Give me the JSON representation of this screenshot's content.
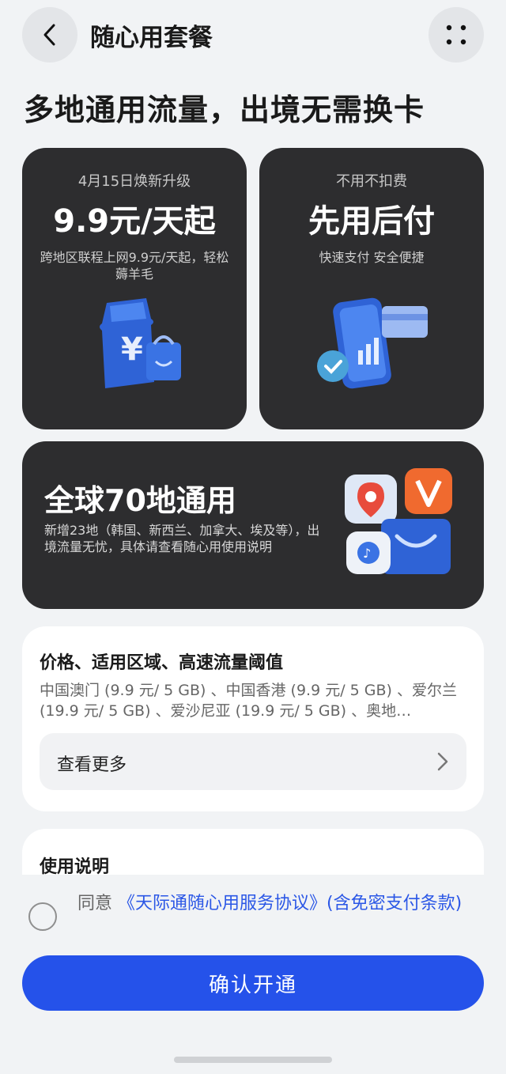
{
  "header": {
    "title": "随心用套餐",
    "back_icon": "chevron-left-icon",
    "more_icon": "more-dots-icon"
  },
  "headline": "多地通用流量，出境无需换卡",
  "cards": [
    {
      "small": "4月15日焕新升级",
      "big": "9.9元/天起",
      "desc": "跨地区联程上网9.9元/天起，轻松薅羊毛",
      "icon": "yen-ticket-bag-icon"
    },
    {
      "small": "不用不扣费",
      "big": "先用后付",
      "desc": "快速支付 安全便捷",
      "icon": "phone-card-check-icon"
    }
  ],
  "global_card": {
    "title": "全球70地通用",
    "desc": "新增23地（韩国、新西兰、加拿大、埃及等），出境流量无忧，具体请查看随心用使用说明",
    "icon": "apps-bag-icon"
  },
  "price_panel": {
    "title": "价格、适用区域、高速流量阈值",
    "text": "中国澳门 (9.9 元/ 5 GB) 、中国香港 (9.9 元/ 5 GB) 、爱尔兰 (19.9 元/ 5 GB) 、爱沙尼亚 (19.9 元/ 5 GB) 、奥地…",
    "more_label": "查看更多"
  },
  "usage_panel": {
    "title": "使用说明"
  },
  "agreement": {
    "prefix": "同意 ",
    "link": "《天际通随心用服务协议》(含免密支付条款)",
    "checked": false
  },
  "confirm_label": "确认开通",
  "colors": {
    "accent": "#2552ea",
    "link": "#2b57e6",
    "dark_card": "#2d2d2f"
  }
}
